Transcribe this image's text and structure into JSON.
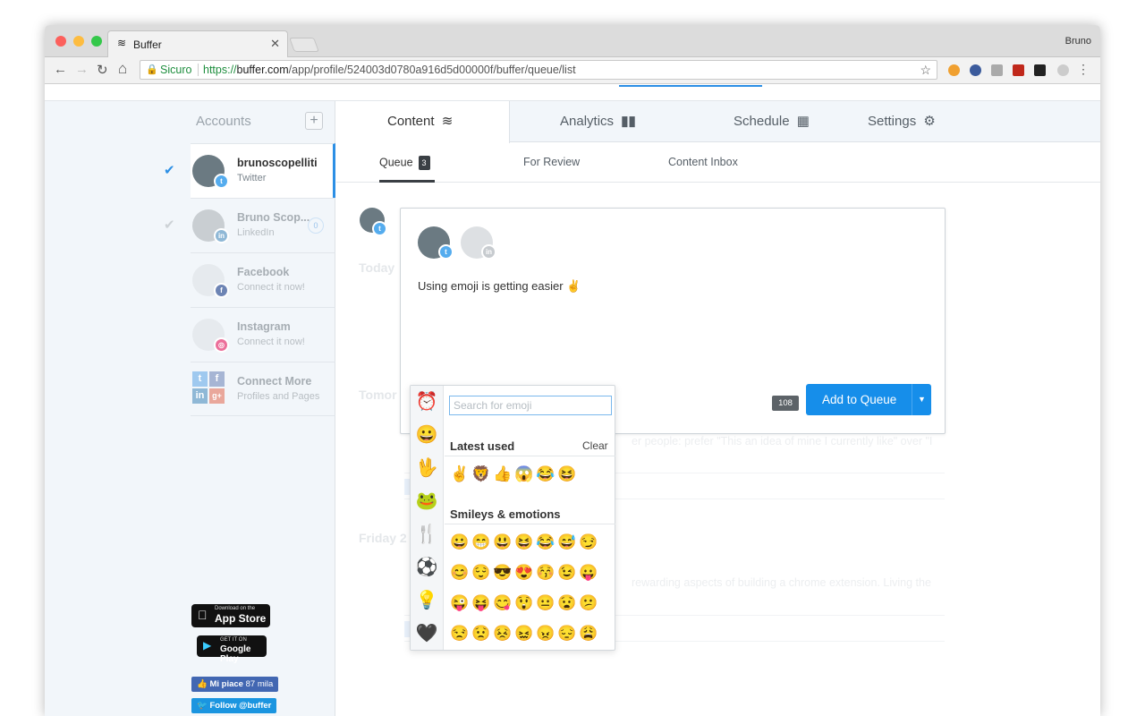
{
  "browser": {
    "tab_title": "Buffer",
    "tab_close": "✕",
    "user": "Bruno",
    "secure_label": "Sicuro",
    "url_scheme": "https://",
    "url_host": "buffer.com",
    "url_path": "/app/profile/524003d0780a916d5d00000f/buffer/queue/list",
    "back": "←",
    "forward": "→",
    "reload": "↻",
    "home": "⌂",
    "star": "☆",
    "menu": "⋮"
  },
  "sidebar": {
    "accounts_title": "Accounts",
    "add": "+",
    "profiles": [
      {
        "name": "brunoscopelliti",
        "network": "Twitter",
        "badge": "t"
      },
      {
        "name": "Bruno Scop...",
        "network": "LinkedIn",
        "badge": "in",
        "count": "0"
      },
      {
        "name": "Facebook",
        "network": "Connect it now!",
        "badge": "f"
      },
      {
        "name": "Instagram",
        "network": "Connect it now!",
        "badge": "◎"
      },
      {
        "name": "Connect More",
        "network": "Profiles and Pages"
      }
    ],
    "appstore_small": "Download on the",
    "appstore_big": "App Store",
    "googleplay_small": "GET IT ON",
    "googleplay_big": "Google Play",
    "fb_like": "Mi piace",
    "fb_count": "87 mila",
    "twitter_follow": "Follow @buffer"
  },
  "tabs": {
    "content": "Content",
    "analytics": "Analytics",
    "schedule": "Schedule",
    "settings": "Settings"
  },
  "subtabs": {
    "queue": "Queue",
    "queue_count": "3",
    "review": "For Review",
    "inbox": "Content Inbox"
  },
  "queue_bg": {
    "today": "Today",
    "tomorrow": "Tomor",
    "friday": "Friday 2",
    "text1": "er people: prefer \"This an idea of mine I currently like\" over \"I",
    "text2": "rewarding aspects of building a chrome extension. Living the"
  },
  "composer": {
    "text": "Using emoji is getting easier ✌",
    "char_count": "108",
    "add_to_queue": "Add to Queue",
    "dropdown": "▼"
  },
  "emoji_picker": {
    "search_placeholder": "Search for emoji",
    "latest_used": "Latest used",
    "clear": "Clear",
    "smileys": "Smileys & emotions",
    "categories": [
      "⏰",
      "😀",
      "🖖",
      "🐸",
      "🍴",
      "⚽",
      "💡",
      "🖤"
    ],
    "latest": [
      "✌",
      "🦁",
      "👍",
      "😱",
      "😂",
      "😆"
    ],
    "rows": [
      [
        "😀",
        "😁",
        "😃",
        "😆",
        "😂",
        "😅",
        "😏"
      ],
      [
        "😊",
        "😌",
        "😎",
        "😍",
        "😚",
        "😉",
        "😛"
      ],
      [
        "😜",
        "😝",
        "😋",
        "😲",
        "😐",
        "😧",
        "😕"
      ],
      [
        "😒",
        "😟",
        "😣",
        "😖",
        "😠",
        "😔",
        "😩"
      ]
    ]
  },
  "colors": {
    "accent": "#168eea",
    "twitter": "#55acee",
    "linkedin": "#0077b5",
    "facebook": "#3b5998",
    "instagram": "#e1306c"
  }
}
